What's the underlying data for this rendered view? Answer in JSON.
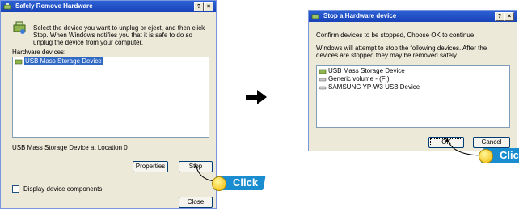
{
  "left_dialog": {
    "title": "Safely Remove Hardware",
    "help_button": "?",
    "close_button": "×",
    "instruction": "Select the device you want to unplug or eject, and then click Stop. When Windows notifies you that it is safe to do so unplug the device from your computer.",
    "hardware_label": "Hardware devices:",
    "devices": [
      "USB Mass Storage Device"
    ],
    "location_text": "USB Mass Storage Device at Location 0",
    "properties_button": "Properties",
    "stop_button": "Stop",
    "display_components_label": "Display device components",
    "close_label": "Close"
  },
  "right_dialog": {
    "title": "Stop a Hardware device",
    "help_button": "?",
    "close_button": "×",
    "confirm_text": "Confirm devices to be stopped, Choose OK to continue.",
    "warning_text": "Windows will attempt to stop the following devices. After the devices are stopped they may be removed safely.",
    "devices": [
      "USB Mass Storage Device",
      "Generic volume - (F:)",
      "SAMSUNG YP-W3 USB Device"
    ],
    "ok_button": "OK",
    "cancel_button": "Cancel"
  },
  "annotations": {
    "click_label_left": "Click",
    "click_label_right": "Click"
  },
  "colors": {
    "titlebar": "#1942b8",
    "dialog_bg": "#ece9d8",
    "selection": "#316ac5",
    "click_badge": "#1a8cd0"
  }
}
